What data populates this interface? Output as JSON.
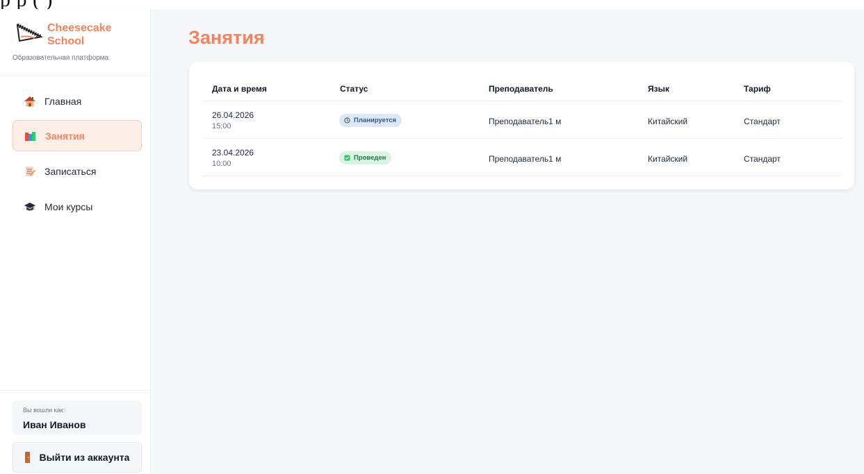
{
  "brand": {
    "name": "Cheesecake School",
    "subtitle": "Образовательная платформа",
    "accent_color": "#f4845f"
  },
  "sidebar": {
    "items": [
      {
        "label": "Главная",
        "icon": "house-icon",
        "active": false
      },
      {
        "label": "Занятия",
        "icon": "books-icon",
        "active": true
      },
      {
        "label": "Записаться",
        "icon": "memo-icon",
        "active": false
      },
      {
        "label": "Мои курсы",
        "icon": "graduation-cap-icon",
        "active": false
      }
    ]
  },
  "user": {
    "caption": "Вы вошли как:",
    "name": "Иван Иванов"
  },
  "logout": {
    "label": "Выйти из аккаунта",
    "icon": "door-icon"
  },
  "main": {
    "title": "Занятия"
  },
  "table": {
    "headers": [
      "Дата и время",
      "Статус",
      "Преподаватель",
      "Язык",
      "Тариф"
    ],
    "rows": [
      {
        "date": "26.04.2026",
        "time": "15:00",
        "status": "Планируется",
        "status_icon": "clock-icon",
        "status_color": "#2f5596",
        "teacher": "Преподаватель1 м",
        "language": "Китайский",
        "tariff": "Стандарт"
      },
      {
        "date": "23.04.2026",
        "time": "10:00",
        "status": "Проведен",
        "status_icon": "check-box-icon",
        "status_color": "#1f7a45",
        "teacher": "Преподаватель1 м",
        "language": "Китайский",
        "tariff": "Стандарт"
      }
    ]
  }
}
